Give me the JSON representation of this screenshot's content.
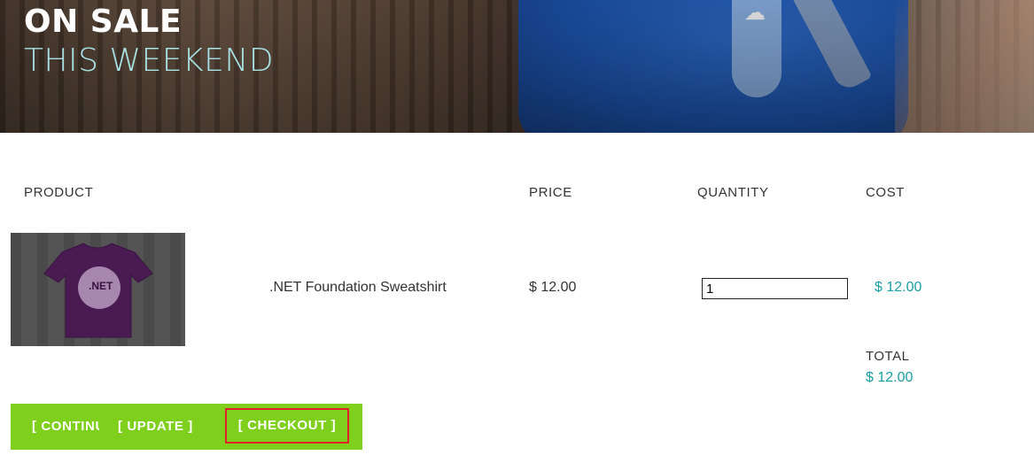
{
  "hero": {
    "title": "ON SALE",
    "subtitle": "THIS WEEKEND"
  },
  "cart": {
    "headers": {
      "product": "PRODUCT",
      "price": "PRICE",
      "quantity": "QUANTITY",
      "cost": "COST"
    },
    "items": [
      {
        "name": ".NET Foundation Sweatshirt",
        "price": "$ 12.00",
        "quantity": "1",
        "cost": "$ 12.00",
        "image_text": ".NET"
      }
    ],
    "total_label": "TOTAL",
    "total_value": "$ 12.00"
  },
  "actions": {
    "continue_label": "[ CONTINUE SHOPPING ]",
    "update_label": "[ UPDATE ]",
    "checkout_label": "[ CHECKOUT ]"
  },
  "colors": {
    "accent_green": "#7fcf1d",
    "price_teal": "#1a9da3",
    "highlight_red": "#e0202a"
  }
}
